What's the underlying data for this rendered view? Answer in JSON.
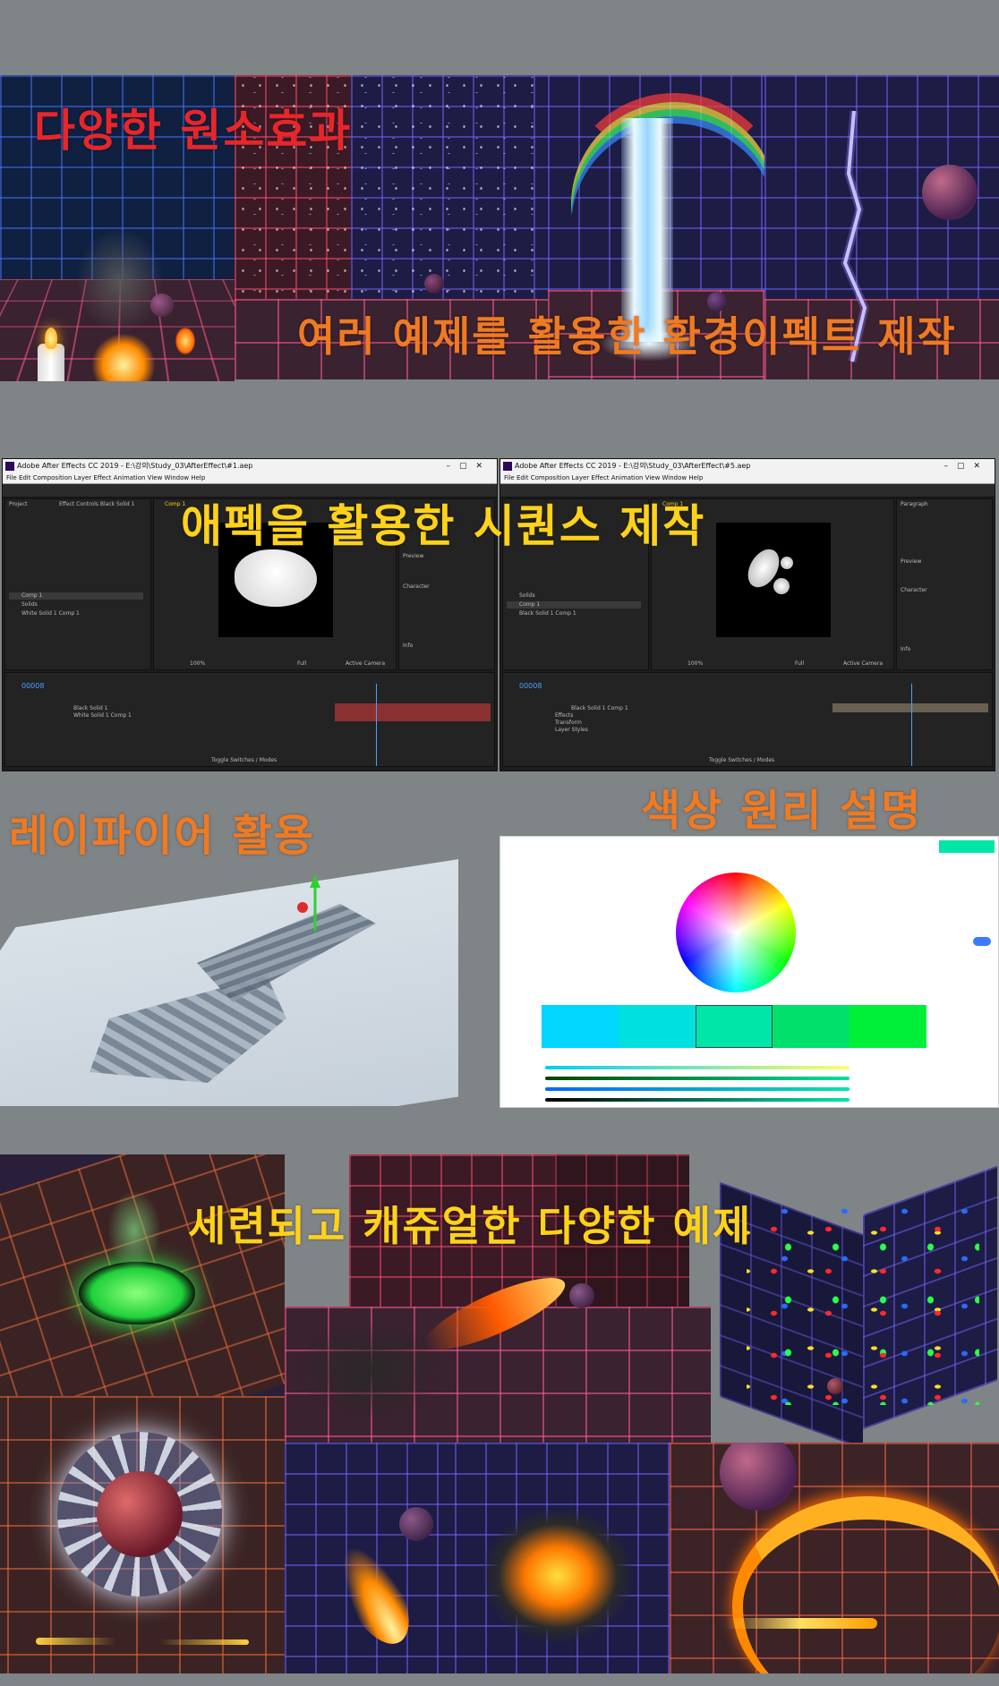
{
  "captions": {
    "elements": "다양한 원소효과",
    "environment": "여러 예제를 활용한 환경이펙트 제작",
    "sequence": "애펙을 활용한 시퀀스 제작",
    "rayfire": "레이파이어 활용",
    "color": "색상 원리 설명",
    "examples": "세련되고 캐쥬얼한 다양한 예제"
  },
  "colors": {
    "caption_red": "#e8262a",
    "caption_orange": "#f07a22",
    "caption_yellow": "#ffd21a",
    "background": "#7f8487"
  },
  "ae_left": {
    "title": "Adobe After Effects CC 2019 - E:\\강의\\Study_03\\AfterEffect\\#1.aep",
    "menu": "File  Edit  Composition  Layer  Effect  Animation  View  Window  Help",
    "project_tab": "Project",
    "effect_tab": "Effect Controls Black Solid 1",
    "comp_tab": "Comp 1",
    "items": [
      "Comp 1",
      "Solids",
      "White Solid 1 Comp 1"
    ],
    "timecode": "00008",
    "layers": [
      "Black Solid 1",
      "White Solid 1 Comp 1"
    ],
    "panels": [
      "Preview",
      "Character",
      "Info"
    ],
    "zoom": "100%",
    "quality": "Full",
    "camera": "Active Camera",
    "toggle": "Toggle Switches / Modes"
  },
  "ae_right": {
    "title": "Adobe After Effects CC 2019 - E:\\강의\\Study_03\\AfterEffect\\#5.aep",
    "menu": "File  Edit  Composition  Layer  Effect  Animation  View  Window  Help",
    "comp_tab": "Comp 1",
    "items": [
      "Solids",
      "Comp 1",
      "Black Solid 1 Comp 1"
    ],
    "timecode": "00008",
    "layers": [
      "Black Solid 1 Comp 1",
      "Effects",
      "Transform",
      "Layer Styles"
    ],
    "panels": [
      "Paragraph",
      "Preview",
      "Character",
      "Info"
    ],
    "zoom": "100%",
    "quality": "Full",
    "camera": "Active Camera",
    "toggle": "Toggle Switches / Modes"
  },
  "icons": [
    "candle-flame-icon",
    "sphere-icon",
    "rainbow-icon",
    "lightning-icon",
    "gizmo-arrow-icon"
  ]
}
